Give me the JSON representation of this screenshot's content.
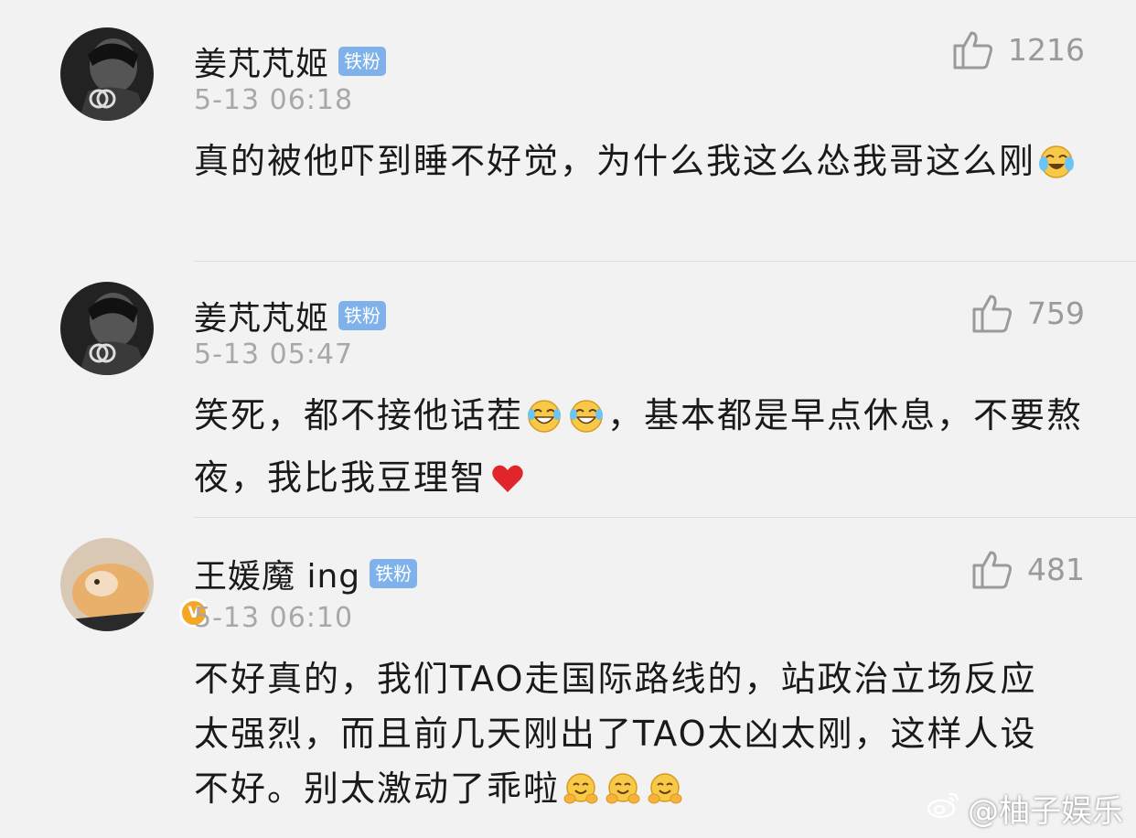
{
  "comments": [
    {
      "username": "姜芃芃姬",
      "badge": "铁粉",
      "timestamp": "5-13 06:18",
      "likes": "1216",
      "text_parts": [
        "真的被他吓到睡不好觉，为什么我这么怂我哥这么刚"
      ],
      "emojis": [
        "cry-laugh-emoji"
      ]
    },
    {
      "username": "姜芃芃姬",
      "badge": "铁粉",
      "timestamp": "5-13 05:47",
      "likes": "759",
      "text_parts": [
        "笑死，都不接他话茬",
        "，基本都是早点休息，不要熬夜，我比我豆理智"
      ],
      "emojis": [
        "laugh-tears-emoji",
        "laugh-tears-emoji",
        "red-heart-emoji"
      ]
    },
    {
      "username": "王媛魔 ing",
      "badge": "铁粉",
      "timestamp": "5-13 06:10",
      "likes": "481",
      "text_parts": [
        "不好真的，我们TAO走国际路线的，站政治立场反应太强烈，而且前几天刚出了TAO太凶太刚，这样人设不好。别太激动了乖啦"
      ],
      "emojis": [
        "hug-emoji",
        "hug-emoji",
        "hug-emoji"
      ],
      "verified": true
    }
  ],
  "watermark": "@柚子娱乐",
  "icons": {
    "like": "thumbs-up-icon",
    "weibo": "weibo-logo-icon"
  },
  "colors": {
    "background": "#f2f2f2",
    "badge": "#7fb2ea",
    "timestamp": "#a8a8a8",
    "verified": "#f5a623"
  }
}
